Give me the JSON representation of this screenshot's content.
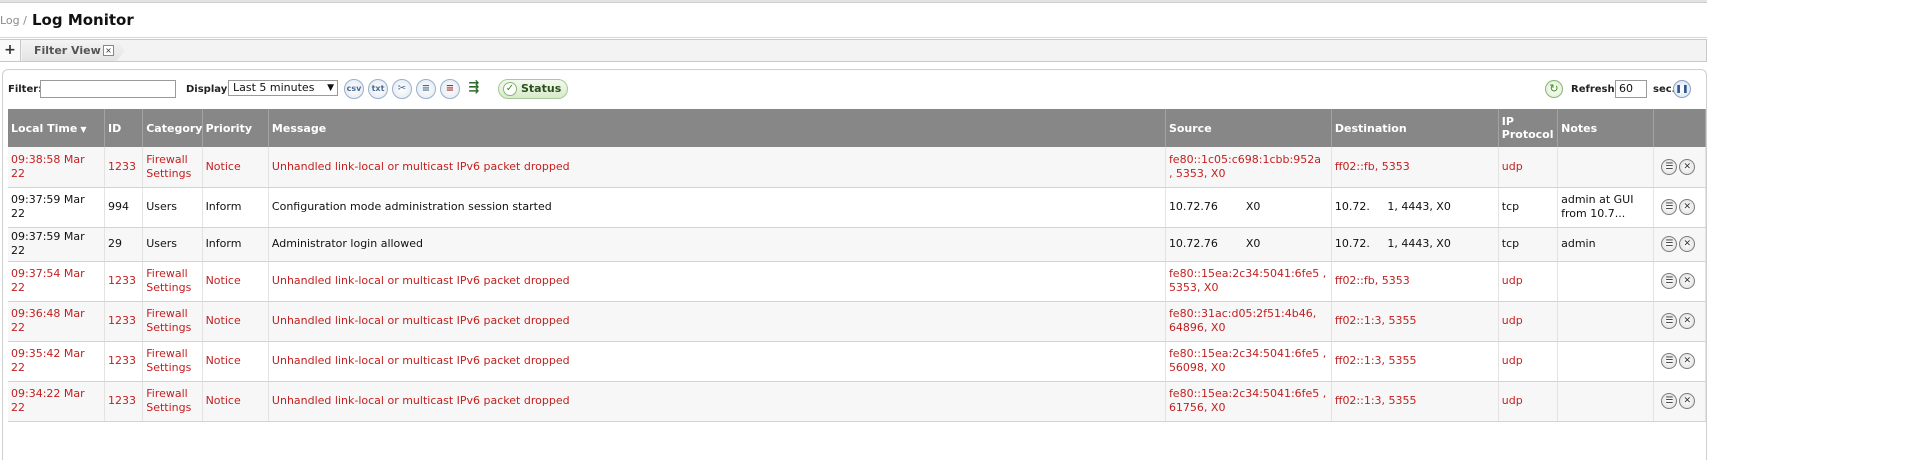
{
  "header": {
    "breadcrumb": "Log /",
    "title": "Log Monitor"
  },
  "tabs": {
    "add_label": "+",
    "active_tab": "Filter View",
    "close_label": "×"
  },
  "toolbar": {
    "filter_label": "Filter:",
    "filter_value": "",
    "display_label": "Display:",
    "display_value": "Last 5 minutes",
    "csv_label": "csv",
    "txt_label": "txt",
    "status_label": "Status",
    "refresh_label": "Refresh:",
    "refresh_value": "60",
    "sec_label": "sec."
  },
  "table": {
    "columns": [
      "Local Time",
      "ID",
      "Category",
      "Priority",
      "Message",
      "Source",
      "Destination",
      "IP Protocol",
      "Notes"
    ],
    "rows": [
      {
        "time": "09:38:58 Mar 22",
        "id": "1233",
        "category": "Firewall Settings",
        "priority": "Notice",
        "message": "Unhandled link-local or multicast IPv6 packet dropped",
        "source": "fe80::1c05:c698:1cbb:952a , 5353, X0",
        "destination": "ff02::fb, 5353",
        "protocol": "udp",
        "notes": "",
        "color": "#c41f1f"
      },
      {
        "time": "09:37:59 Mar 22",
        "id": "994",
        "category": "Users",
        "priority": "Inform",
        "message": "Configuration mode administration session started",
        "source": "10.72.76        X0",
        "destination": "10.72.     1, 4443, X0",
        "protocol": "tcp",
        "notes": "admin at GUI from 10.7...",
        "color": "#111111"
      },
      {
        "time": "09:37:59 Mar 22",
        "id": "29",
        "category": "Users",
        "priority": "Inform",
        "message": "Administrator login allowed",
        "source": "10.72.76        X0",
        "destination": "10.72.     1, 4443, X0",
        "protocol": "tcp",
        "notes": "admin",
        "color": "#111111"
      },
      {
        "time": "09:37:54 Mar 22",
        "id": "1233",
        "category": "Firewall Settings",
        "priority": "Notice",
        "message": "Unhandled link-local or multicast IPv6 packet dropped",
        "source": "fe80::15ea:2c34:5041:6fe5 , 5353, X0",
        "destination": "ff02::fb, 5353",
        "protocol": "udp",
        "notes": "",
        "color": "#c41f1f"
      },
      {
        "time": "09:36:48 Mar 22",
        "id": "1233",
        "category": "Firewall Settings",
        "priority": "Notice",
        "message": "Unhandled link-local or multicast IPv6 packet dropped",
        "source": "fe80::31ac:d05:2f51:4b46, 64896, X0",
        "destination": "ff02::1:3, 5355",
        "protocol": "udp",
        "notes": "",
        "color": "#c41f1f"
      },
      {
        "time": "09:35:42 Mar 22",
        "id": "1233",
        "category": "Firewall Settings",
        "priority": "Notice",
        "message": "Unhandled link-local or multicast IPv6 packet dropped",
        "source": "fe80::15ea:2c34:5041:6fe5 , 56098, X0",
        "destination": "ff02::1:3, 5355",
        "protocol": "udp",
        "notes": "",
        "color": "#c41f1f"
      },
      {
        "time": "09:34:22 Mar 22",
        "id": "1233",
        "category": "Firewall Settings",
        "priority": "Notice",
        "message": "Unhandled link-local or multicast IPv6 packet dropped",
        "source": "fe80::15ea:2c34:5041:6fe5 , 61756, X0",
        "destination": "ff02::1:3, 5355",
        "protocol": "udp",
        "notes": "",
        "color": "#c41f1f"
      }
    ]
  },
  "icons": {
    "csv": "csv-export-icon",
    "txt": "txt-export-icon",
    "settings": "tools-icon",
    "filter_add": "filter-add-icon",
    "filter_clear": "filter-clear-icon",
    "export": "export-icon",
    "refresh": "refresh-icon",
    "pause": "pause-icon",
    "row_detail": "list-icon",
    "row_delete": "close-icon"
  },
  "colors": {
    "alert_text": "#c41f1f",
    "header_bg": "#878787",
    "status_green": "#3d8b1c"
  }
}
